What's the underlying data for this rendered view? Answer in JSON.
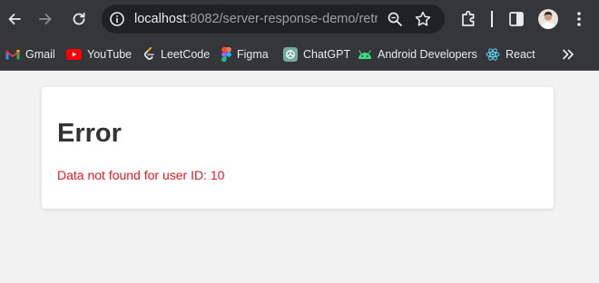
{
  "browser": {
    "url_host": "localhost",
    "url_path": ":8082/server-response-demo/retri..."
  },
  "bookmarks": [
    {
      "label": "Gmail"
    },
    {
      "label": "YouTube"
    },
    {
      "label": "LeetCode"
    },
    {
      "label": "Figma"
    },
    {
      "label": "ChatGPT"
    },
    {
      "label": "Android Developers"
    },
    {
      "label": "React"
    }
  ],
  "page": {
    "title": "Error",
    "message": "Data not found for user ID: 10"
  },
  "colors": {
    "toolbar_bg": "#35363a",
    "omnibox_bg": "#202124",
    "page_bg": "#f2f2f2",
    "card_bg": "#ffffff",
    "title_color": "#333333",
    "error_color": "#e5191f"
  }
}
